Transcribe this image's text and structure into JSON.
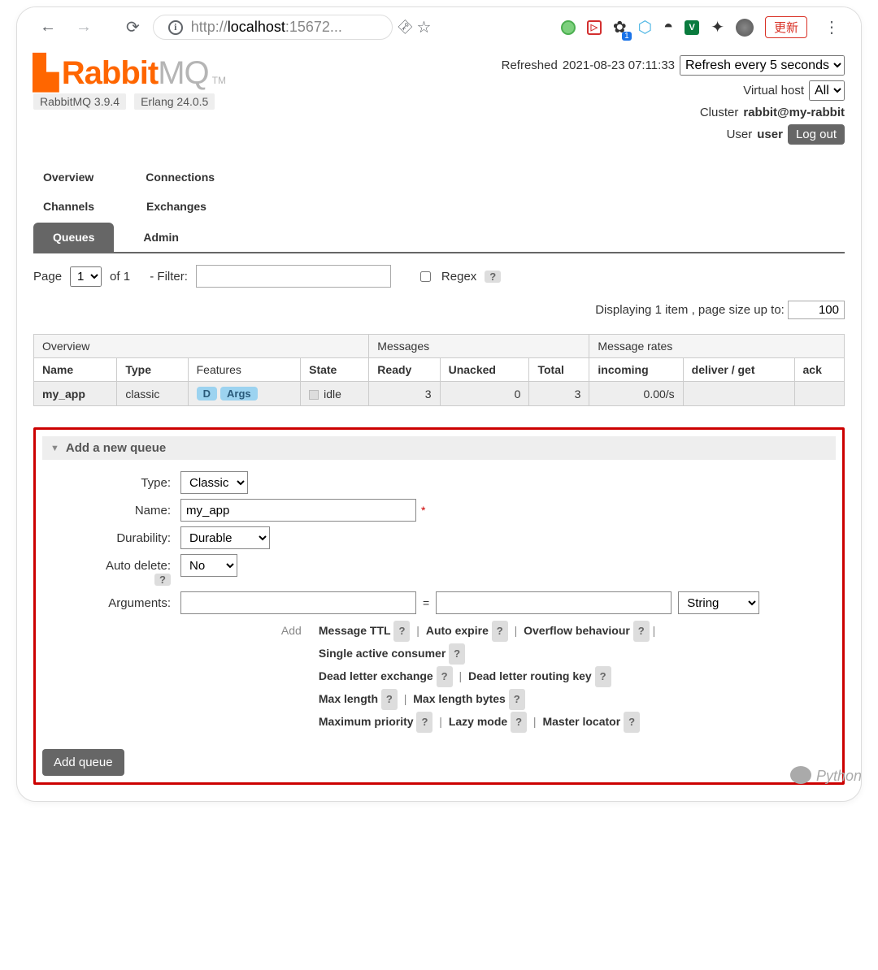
{
  "browser": {
    "url_display": "http://localhost:15672...",
    "update_label": "更新"
  },
  "meta": {
    "refreshed_label": "Refreshed",
    "refreshed_time": "2021-08-23 07:11:33",
    "refresh_options": [
      "Refresh every 5 seconds"
    ],
    "refresh_selected": "Refresh every 5 seconds",
    "vhost_label": "Virtual host",
    "vhost_selected": "All",
    "cluster_label": "Cluster",
    "cluster_value": "rabbit@my-rabbit",
    "user_label": "User",
    "user_value": "user",
    "logout_label": "Log out"
  },
  "versions": {
    "rabbit": "RabbitMQ 3.9.4",
    "erlang": "Erlang 24.0.5"
  },
  "tabs": {
    "overview": "Overview",
    "connections": "Connections",
    "channels": "Channels",
    "exchanges": "Exchanges",
    "queues": "Queues",
    "admin": "Admin",
    "active": "Queues"
  },
  "filter": {
    "page_label": "Page",
    "page_value": "1",
    "of_label": "of 1",
    "filter_label": "- Filter:",
    "filter_value": "",
    "regex_label": "Regex",
    "displaying": "Displaying 1 item , page size up to:",
    "page_size": "100"
  },
  "table": {
    "groups": {
      "overview": "Overview",
      "messages": "Messages",
      "rates": "Message rates"
    },
    "cols": {
      "name": "Name",
      "type": "Type",
      "features": "Features",
      "state": "State",
      "ready": "Ready",
      "unacked": "Unacked",
      "total": "Total",
      "incoming": "incoming",
      "deliver": "deliver / get",
      "ack": "ack"
    },
    "rows": [
      {
        "name": "my_app",
        "type": "classic",
        "features": [
          "D",
          "Args"
        ],
        "state": "idle",
        "ready": "3",
        "unacked": "0",
        "total": "3",
        "incoming": "0.00/s",
        "deliver": "",
        "ack": ""
      }
    ]
  },
  "add_queue": {
    "title": "Add a new queue",
    "type_label": "Type:",
    "type_value": "Classic",
    "name_label": "Name:",
    "name_value": "my_app",
    "durability_label": "Durability:",
    "durability_value": "Durable",
    "autodelete_label": "Auto delete:",
    "autodelete_value": "No",
    "arguments_label": "Arguments:",
    "arg_key": "",
    "arg_val": "",
    "arg_type": "String",
    "add_label": "Add",
    "shortcuts": [
      [
        "Message TTL",
        "Auto expire",
        "Overflow behaviour",
        ""
      ],
      [
        "Single active consumer"
      ],
      [
        "Dead letter exchange",
        "Dead letter routing key"
      ],
      [
        "Max length",
        "Max length bytes"
      ],
      [
        "Maximum priority",
        "Lazy mode",
        "Master locator"
      ]
    ],
    "submit_label": "Add queue"
  },
  "watermark": "Python七号"
}
